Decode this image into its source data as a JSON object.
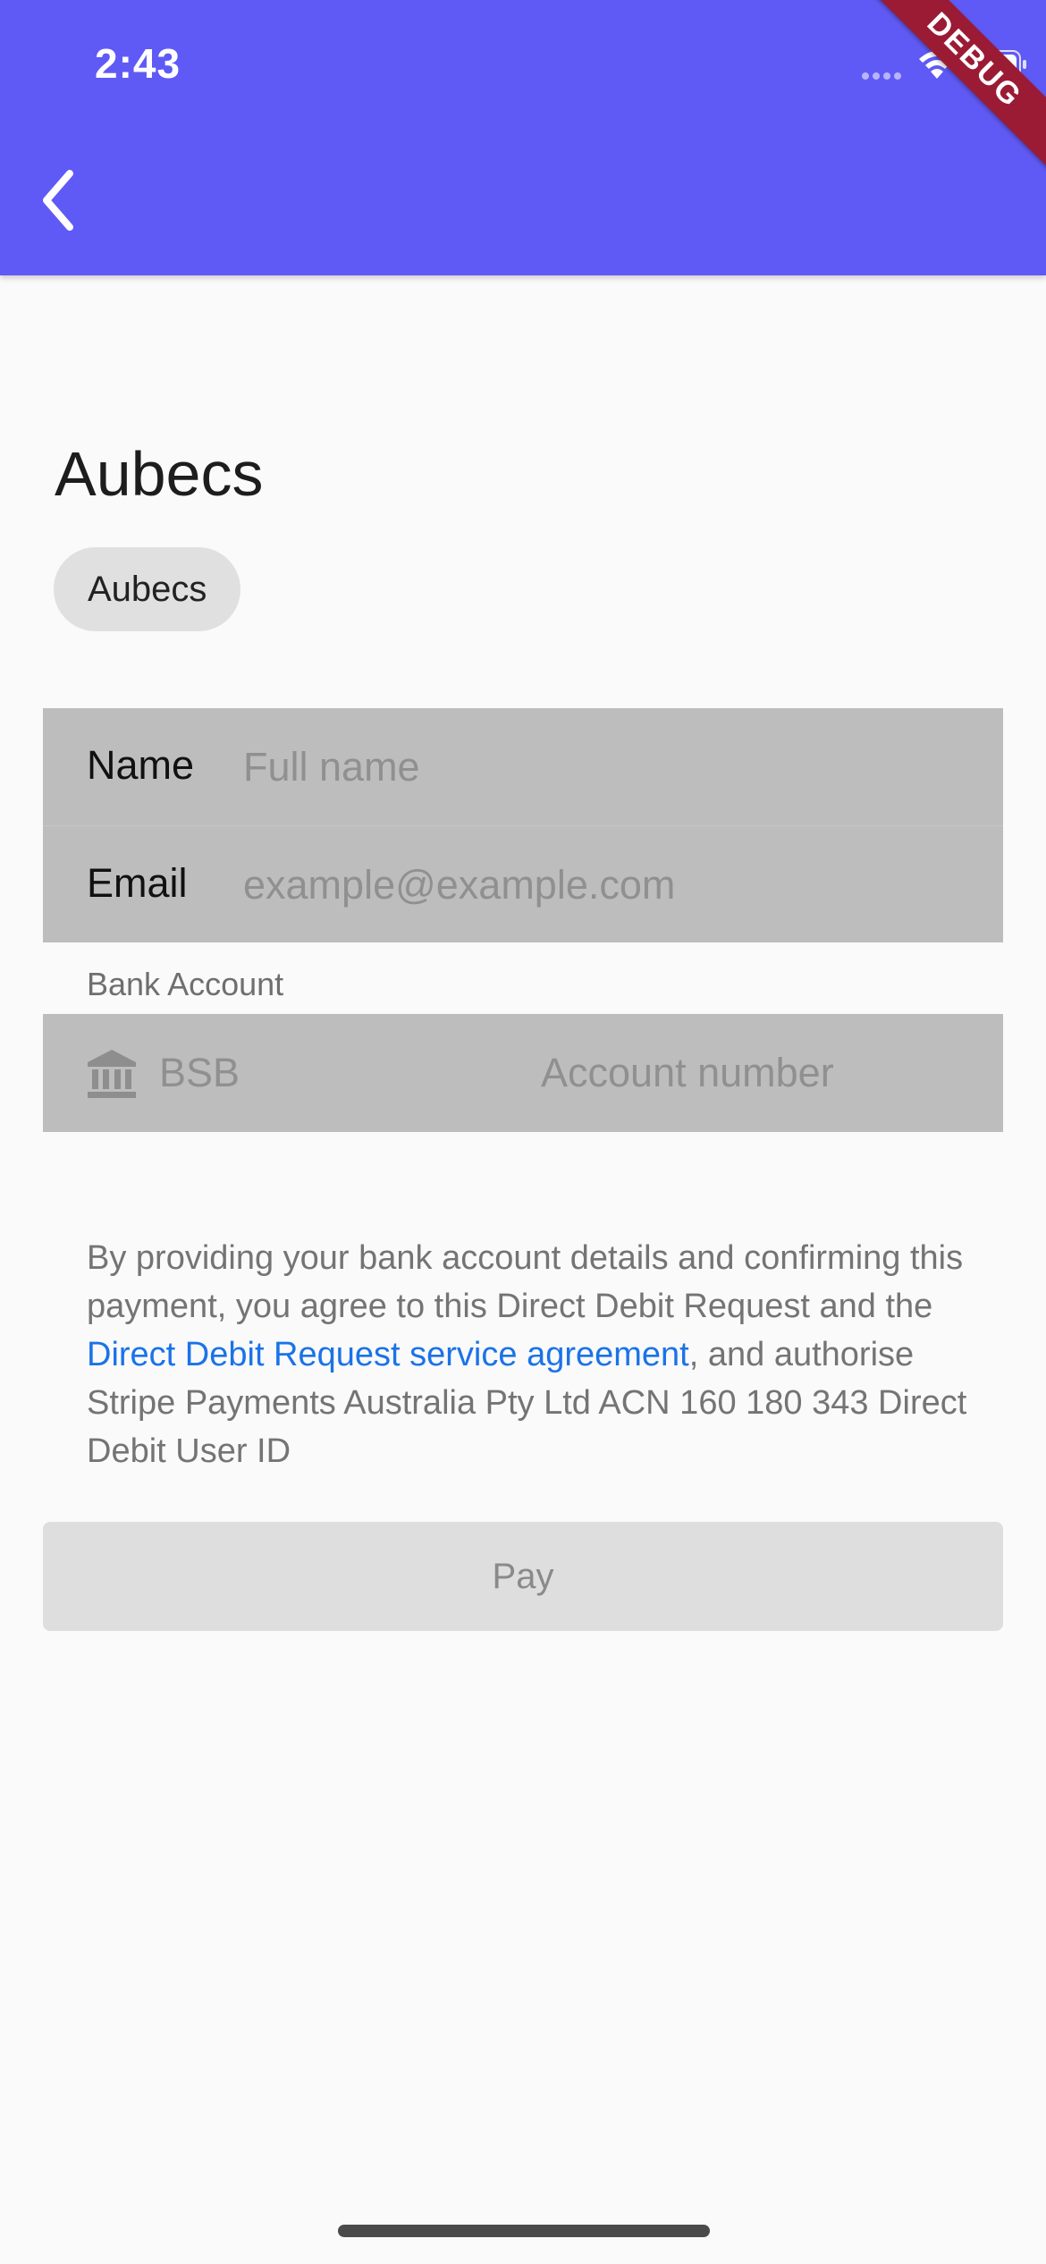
{
  "status_bar": {
    "time": "2:43"
  },
  "app_bar": {
    "background": "#5f5af6",
    "back_icon": "chevron-left-icon",
    "debug_banner": "DEBUG"
  },
  "page": {
    "title": "Aubecs",
    "chip_label": "Aubecs"
  },
  "form": {
    "name": {
      "label": "Name",
      "placeholder": "Full name",
      "value": ""
    },
    "email": {
      "label": "Email",
      "placeholder": "example@example.com",
      "value": ""
    },
    "bank_section_label": "Bank Account",
    "bank_icon": "bank-icon",
    "bsb": {
      "placeholder": "BSB",
      "value": ""
    },
    "account_number": {
      "placeholder": "Account number",
      "value": ""
    }
  },
  "mandate": {
    "text_before_link": "By providing your bank account details and confirming this payment, you agree to this Direct Debit Request and the ",
    "link_text": "Direct Debit Request service agreement",
    "text_after_link": ", and authorise Stripe Payments Australia Pty Ltd ACN 160 180 343 Direct Debit User ID",
    "link_color": "#1a73e8"
  },
  "pay_button": {
    "label": "Pay",
    "enabled": false
  }
}
